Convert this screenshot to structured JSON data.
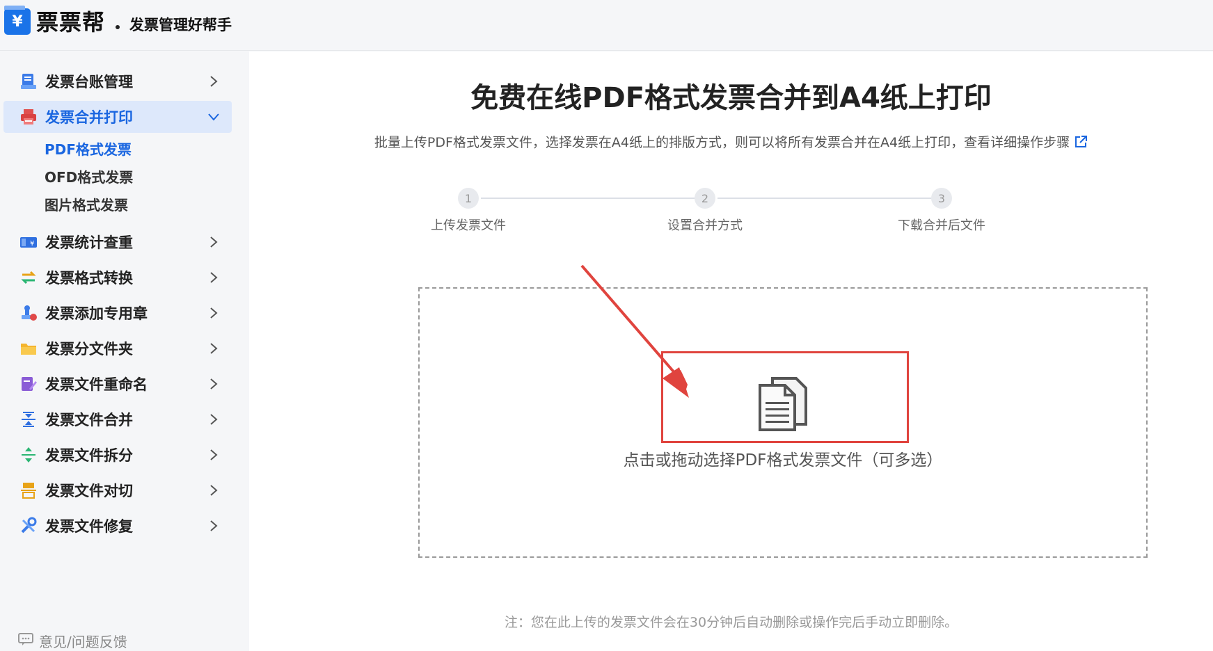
{
  "header": {
    "logo_symbol": "¥",
    "brand_name": "票票帮",
    "slogan": "发票管理好帮手"
  },
  "sidebar": {
    "items": [
      {
        "label": "发票台账管理",
        "icon": "ledger-icon",
        "expanded": false
      },
      {
        "label": "发票合并打印",
        "icon": "printer-icon",
        "expanded": true
      },
      {
        "label": "发票统计查重",
        "icon": "invoice-stats-icon",
        "expanded": false
      },
      {
        "label": "发票格式转换",
        "icon": "convert-arrows-icon",
        "expanded": false
      },
      {
        "label": "发票添加专用章",
        "icon": "stamp-icon",
        "expanded": false
      },
      {
        "label": "发票分文件夹",
        "icon": "folder-icon",
        "expanded": false
      },
      {
        "label": "发票文件重命名",
        "icon": "rename-pen-icon",
        "expanded": false
      },
      {
        "label": "发票文件合并",
        "icon": "merge-icon",
        "expanded": false
      },
      {
        "label": "发票文件拆分",
        "icon": "split-icon",
        "expanded": false
      },
      {
        "label": "发票文件对切",
        "icon": "cut-icon",
        "expanded": false
      },
      {
        "label": "发票文件修复",
        "icon": "repair-tools-icon",
        "expanded": false
      }
    ],
    "sub_items": [
      {
        "label": "PDF格式发票",
        "active": true
      },
      {
        "label": "OFD格式发票",
        "active": false
      },
      {
        "label": "图片格式发票",
        "active": false
      }
    ],
    "feedback_label": "意见/问题反馈"
  },
  "main": {
    "title": "免费在线PDF格式发票合并到A4纸上打印",
    "description": "批量上传PDF格式发票文件，选择发票在A4纸上的排版方式，则可以将所有发票合并在A4纸上打印，查看详细操作步骤",
    "steps": [
      {
        "number": "1",
        "label": "上传发票文件"
      },
      {
        "number": "2",
        "label": "设置合并方式"
      },
      {
        "number": "3",
        "label": "下载合并后文件"
      }
    ],
    "upload_text": "点击或拖动选择PDF格式发票文件（可多选）",
    "note": "注：您在此上传的发票文件会在30分钟后自动删除或操作完后手动立即删除。"
  },
  "colors": {
    "accent": "#1a66e0",
    "active_bg": "#dde8fb",
    "highlight_red": "#e0443e"
  }
}
